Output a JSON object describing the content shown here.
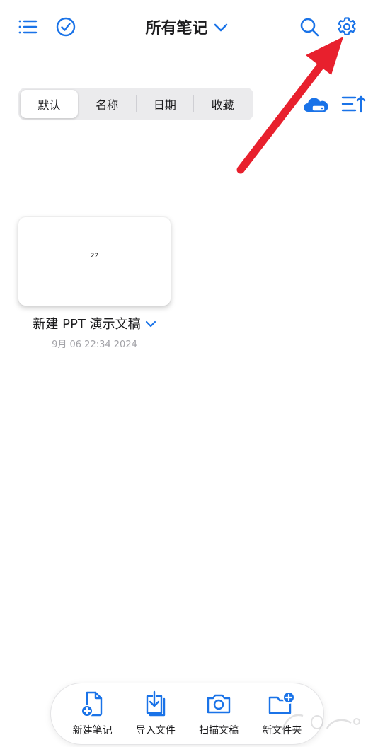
{
  "header": {
    "title": "所有笔记",
    "left_icons": [
      "list-icon",
      "check-circle-icon"
    ],
    "right_icons": [
      "search-icon",
      "gear-icon"
    ]
  },
  "sort_tabs": {
    "items": [
      "默认",
      "名称",
      "日期",
      "收藏"
    ],
    "active_index": 0
  },
  "toolbar_right_icons": [
    "cloud-icon",
    "sort-order-icon"
  ],
  "notes": [
    {
      "thumbnail_text": "22",
      "title": "新建 PPT 演示文稿",
      "date": "9月 06 22:34 2024"
    }
  ],
  "bottom_toolbar": {
    "items": [
      {
        "label": "新建笔记",
        "icon": "new-note-icon"
      },
      {
        "label": "导入文件",
        "icon": "import-file-icon"
      },
      {
        "label": "扫描文稿",
        "icon": "camera-icon"
      },
      {
        "label": "新文件夹",
        "icon": "new-folder-icon"
      }
    ]
  },
  "colors": {
    "accent": "#1a73e8",
    "arrow": "#e8202d",
    "text": "#1c1c1e",
    "muted": "#a3a3a8"
  }
}
